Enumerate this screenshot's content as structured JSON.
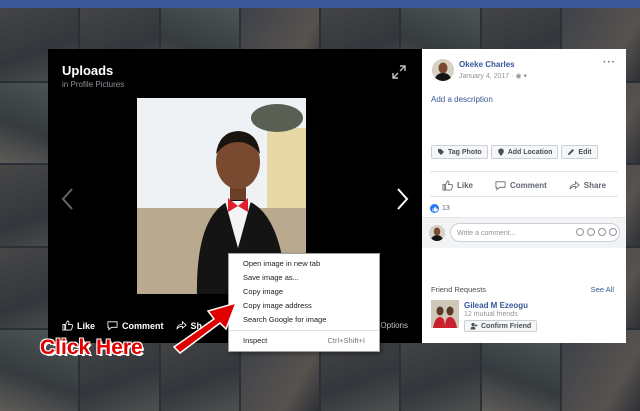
{
  "viewer": {
    "title": "Uploads",
    "subtitle": "in Profile Pictures",
    "actions": {
      "like": "Like",
      "comment": "Comment",
      "share": "Sh"
    },
    "options": "Options"
  },
  "context_menu": {
    "items": [
      {
        "label": "Open image in new tab",
        "shortcut": ""
      },
      {
        "label": "Save image as...",
        "shortcut": ""
      },
      {
        "label": "Copy image",
        "shortcut": ""
      },
      {
        "label": "Copy image address",
        "shortcut": ""
      },
      {
        "label": "Search Google for image",
        "shortcut": ""
      },
      {
        "label": "Inspect",
        "shortcut": "Ctrl+Shift+I"
      }
    ]
  },
  "annotation": {
    "text": "Click Here",
    "color": "#e00000"
  },
  "panel": {
    "author": "Okeke Charles",
    "date": "January 4, 2017 · ",
    "add_description": "Add a description",
    "tag_buttons": {
      "tag": "Tag Photo",
      "location": "Add Location",
      "edit": "Edit"
    },
    "actions": {
      "like": "Like",
      "comment": "Comment",
      "share": "Share"
    },
    "reaction_count": "13",
    "comment_placeholder": "Write a comment...",
    "friend_requests": {
      "title": "Friend Requests",
      "see_all": "See All",
      "name": "Gilead M Ezeogu",
      "mutual": "12 mutual friends",
      "confirm": "Confirm Friend"
    }
  },
  "colors": {
    "link": "#365899",
    "brand": "#3b5998",
    "like": "#2078f4"
  }
}
